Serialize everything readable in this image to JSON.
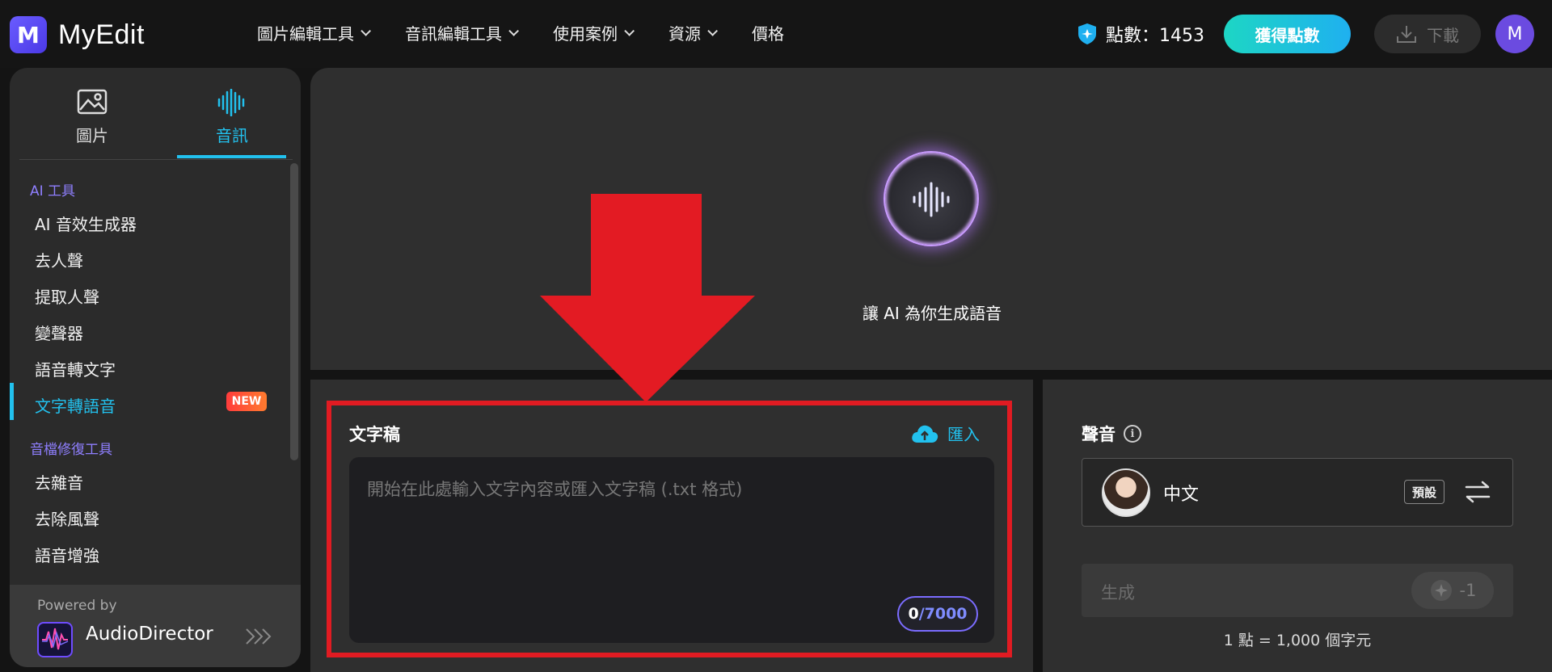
{
  "header": {
    "app_name": "MyEdit",
    "logo_letter": "M",
    "nav": [
      {
        "label": "圖片編輯工具"
      },
      {
        "label": "音訊編輯工具"
      },
      {
        "label": "使用案例"
      },
      {
        "label": "資源"
      },
      {
        "label": "價格"
      }
    ],
    "points_label": "點數：1453",
    "get_points_button": "獲得點數",
    "download_button": "下載",
    "user_initial": "M"
  },
  "sidebar": {
    "tabs": [
      {
        "label": "圖片",
        "icon": "image-icon"
      },
      {
        "label": "音訊",
        "icon": "audio-wave-icon",
        "active": true
      }
    ],
    "sections": [
      {
        "label": "AI 工具",
        "items": [
          {
            "label": "AI 音效生成器"
          },
          {
            "label": "去人聲"
          },
          {
            "label": "提取人聲"
          },
          {
            "label": "變聲器"
          },
          {
            "label": "語音轉文字"
          },
          {
            "label": "文字轉語音",
            "active": true,
            "badge": "NEW"
          }
        ]
      },
      {
        "label": "音檔修復工具",
        "items": [
          {
            "label": "去雜音"
          },
          {
            "label": "去除風聲"
          },
          {
            "label": "語音增強"
          }
        ]
      }
    ],
    "powered_by": "Powered by",
    "powered_product": "AudioDirector"
  },
  "hero": {
    "caption": "讓 AI 為你生成語音"
  },
  "script_panel": {
    "title": "文字稿",
    "import_label": "匯入",
    "placeholder": "開始在此處輸入文字內容或匯入文字稿 (.txt 格式)",
    "count_current": "0",
    "count_max": "/7000"
  },
  "voice_panel": {
    "title": "聲音",
    "voice_name": "中文",
    "preset_label": "預設",
    "generate_label": "生成",
    "generate_cost": "-1",
    "rate_note": "1 點 = 1,000 個字元"
  },
  "colors": {
    "accent": "#22c1ee",
    "annotation_red": "#e11b22",
    "brand_purple": "#6a5cff"
  }
}
